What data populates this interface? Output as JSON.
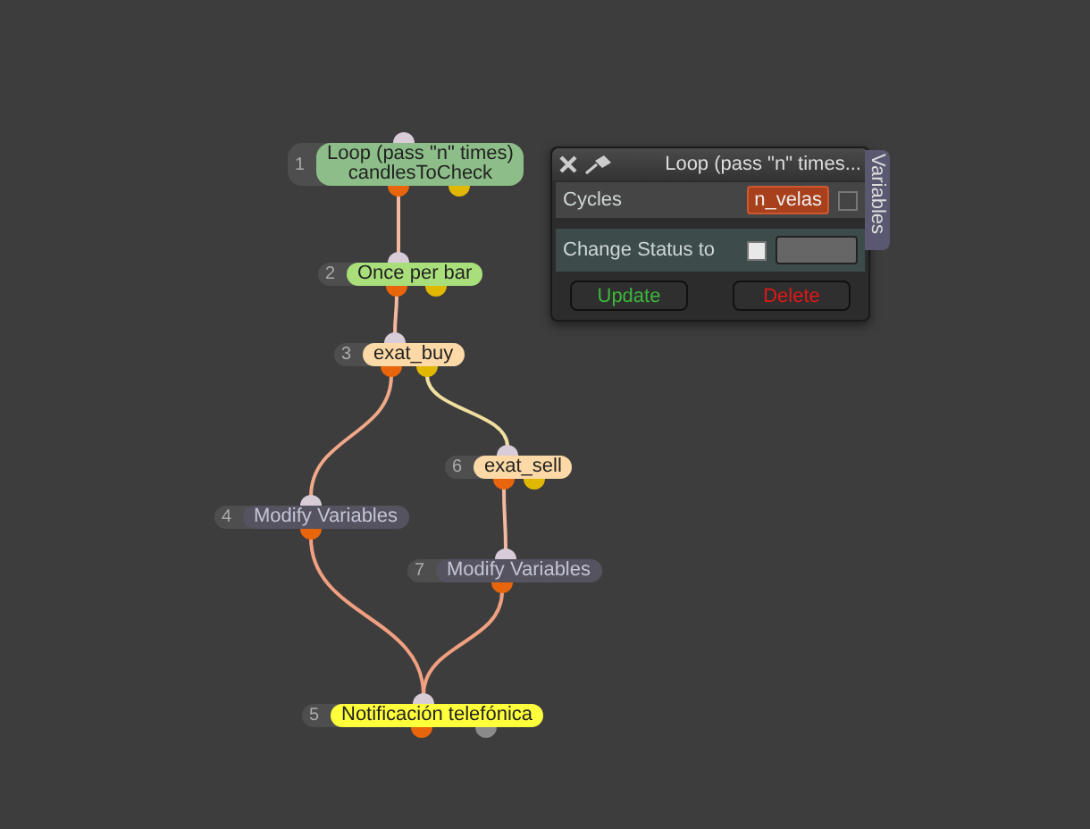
{
  "nodes": [
    {
      "number": "1",
      "label": [
        "Loop (pass \"n\" times)",
        "candlesToCheck"
      ],
      "color": "#8dbd88"
    },
    {
      "number": "2",
      "label": [
        "Once per bar"
      ],
      "color": "#a9df7a"
    },
    {
      "number": "3",
      "label": [
        "exat_buy"
      ],
      "color": "#fcd9a6"
    },
    {
      "number": "6",
      "label": [
        "exat_sell"
      ],
      "color": "#fcd9a6"
    },
    {
      "number": "4",
      "label": [
        "Modify Variables"
      ],
      "color": "#55535f"
    },
    {
      "number": "7",
      "label": [
        "Modify Variables"
      ],
      "color": "#55535f"
    },
    {
      "number": "5",
      "label": [
        "Notificación telefónica"
      ],
      "color": "#ffff3c"
    }
  ],
  "panel": {
    "title": "Loop (pass \"n\" times...",
    "side_tab": "Variables",
    "cycles": {
      "label": "Cycles",
      "value": "n_velas",
      "checked": false
    },
    "status": {
      "label": "Change Status to",
      "checked": false
    },
    "buttons": [
      "Update",
      "Delete"
    ]
  }
}
